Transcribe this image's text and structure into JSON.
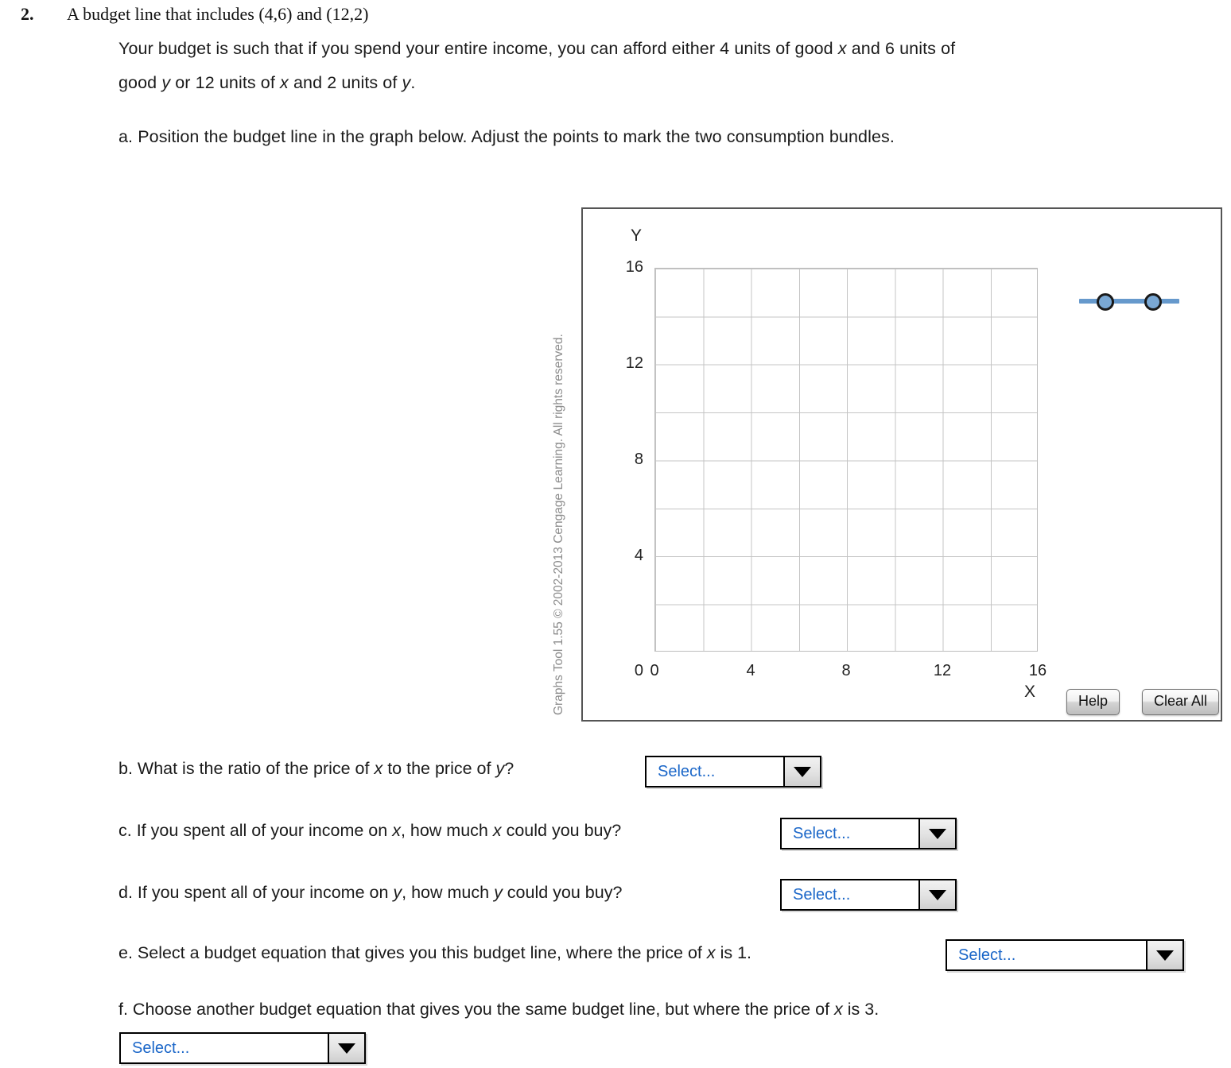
{
  "question": {
    "number": "2.",
    "title": "A budget line that includes (4,6) and (12,2)",
    "intro_line_1_a": "Your budget is such that if you spend your entire income, you can afford either 4 units of good ",
    "intro_line_1_x": "x",
    "intro_line_1_b": " and 6 units of",
    "intro_line_2_a": "good ",
    "intro_line_2_y": "y",
    "intro_line_2_b": " or 12 units of ",
    "intro_line_2_x": "x",
    "intro_line_2_c": " and 2 units of ",
    "intro_line_2_y2": "y",
    "intro_line_2_d": ".",
    "part_a": "a. Position the budget line in the graph below.  Adjust the points to mark the two consumption bundles."
  },
  "graph_tool": {
    "copyright": "Graphs Tool 1.55 © 2002-2013 Cengage Learning. All rights reserved.",
    "y_axis_label": "Y",
    "x_axis_label": "X",
    "help_label": "Help",
    "clear_all_label": "Clear All",
    "line_color": "#6699cc",
    "handle_fill": "#7aa8d4",
    "handle_stroke": "#1a1a1a",
    "grid_color": "#c4c4c4"
  },
  "chart_data": {
    "type": "scatter",
    "title": "",
    "xlabel": "X",
    "ylabel": "Y",
    "xlim": [
      0,
      16
    ],
    "ylim": [
      0,
      16
    ],
    "xticks": [
      "0",
      "4",
      "8",
      "12",
      "16"
    ],
    "xtick_values": [
      0,
      4,
      8,
      12,
      16
    ],
    "yticks": [
      "0",
      "4",
      "8",
      "12",
      "16"
    ],
    "ytick_values": [
      0,
      4,
      8,
      12,
      16
    ],
    "grid": true,
    "grid_step": 2,
    "grid_cells": 8,
    "legend": "none",
    "series": [
      {
        "name": "budget-line-widget",
        "note": "draggable line with two point handles, currently parked outside the plot area at upper right (unplaced)",
        "points": [],
        "placed_in_plot": false
      }
    ],
    "target_bundles": [
      {
        "x": 4,
        "y": 6
      },
      {
        "x": 12,
        "y": 2
      }
    ]
  },
  "parts": {
    "b": {
      "text_1": "b. What is the ratio of the price of ",
      "x1": "x",
      "text_2": " to the price of ",
      "y1": "y",
      "text_3": "?",
      "select_value": "Select..."
    },
    "c": {
      "text_1": "c. If you spent all of your income on ",
      "x1": "x",
      "text_2": ", how much ",
      "x2": "x",
      "text_3": " could you buy?",
      "select_value": "Select..."
    },
    "d": {
      "text_1": "d. If you spent all of your income on ",
      "y1": "y",
      "text_2": ", how much ",
      "y2": "y",
      "text_3": " could you buy?",
      "select_value": "Select..."
    },
    "e": {
      "text_1": "e. Select a budget equation that gives you this budget line, where the price of ",
      "x1": "x",
      "text_2": " is 1.",
      "select_value": "Select..."
    },
    "f": {
      "text_1": "f. Choose another budget equation that gives you the same budget line, but where the price of ",
      "x1": "x",
      "text_2": " is 3.",
      "select_value": "Select..."
    }
  }
}
